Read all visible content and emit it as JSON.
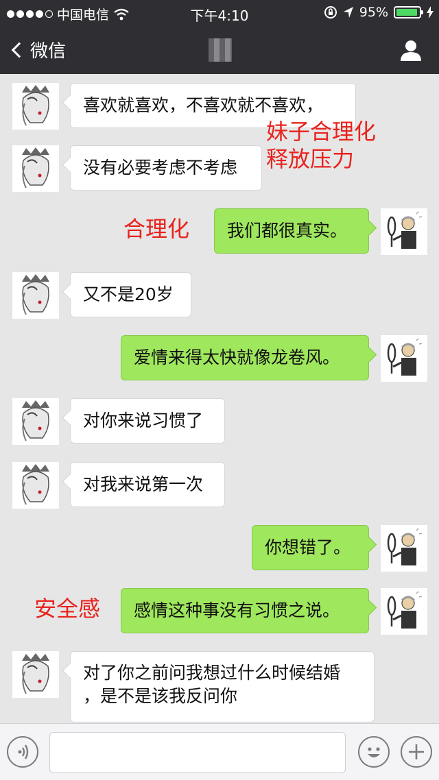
{
  "status_bar": {
    "carrier": "中国电信",
    "time": "下午4:10",
    "battery": "95%"
  },
  "nav": {
    "back_label": "微信"
  },
  "messages": [
    {
      "side": "in",
      "text": "喜欢就喜欢，不喜欢就不喜欢，"
    },
    {
      "side": "in",
      "text": "没有必要考虑不考虑"
    },
    {
      "side": "out",
      "text": "我们都很真实。"
    },
    {
      "side": "in",
      "text": "又不是20岁"
    },
    {
      "side": "out",
      "text": "爱情来得太快就像龙卷风。"
    },
    {
      "side": "in",
      "text": "对你来说习惯了"
    },
    {
      "side": "in",
      "text": "对我来说第一次"
    },
    {
      "side": "out",
      "text": "你想错了。"
    },
    {
      "side": "out",
      "text": "感情这种事没有习惯之说。"
    },
    {
      "side": "in",
      "line1": "对了你之前问我想过什么时候结婚",
      "line2": "，是不是该我反问你"
    }
  ],
  "annotations": {
    "note1_line1": "妹子合理化",
    "note1_line2": "释放压力",
    "note2": "合理化",
    "note3": "安全感"
  },
  "colors": {
    "nav_bg": "#2f2f33",
    "chat_bg": "#e6e6e6",
    "outgoing_bubble": "#9fe75d",
    "annotation": "#e8231e",
    "battery": "#4cd964"
  },
  "icons": [
    "signal-dots-icon",
    "wifi-icon",
    "lock-rotation-icon",
    "location-arrow-icon",
    "battery-icon",
    "charging-bolt-icon",
    "back-chevron-icon",
    "profile-icon",
    "voice-icon",
    "emoji-icon",
    "plus-icon"
  ]
}
